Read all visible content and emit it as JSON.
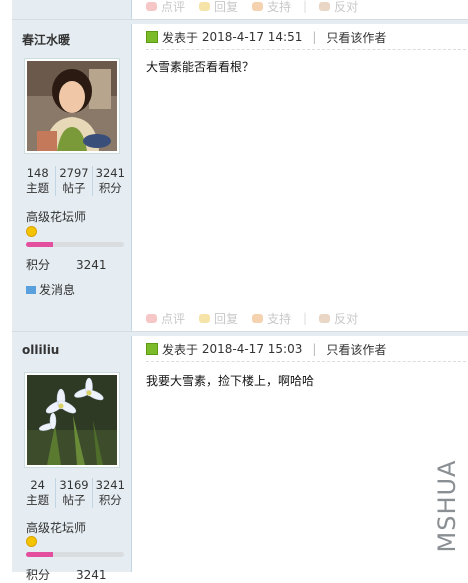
{
  "actions": {
    "comment": "点评",
    "reply": "回复",
    "support": "支持",
    "oppose": "反对"
  },
  "posts": [
    {
      "username": "春江水暖",
      "stats": [
        {
          "value": "148",
          "label": "主题"
        },
        {
          "value": "2797",
          "label": "帖子"
        },
        {
          "value": "3241",
          "label": "积分"
        }
      ],
      "rank": "高级花坛师",
      "level_progress": 0.28,
      "points_label": "积分",
      "points_value": "3241",
      "message_link": "发消息",
      "posted_prefix": "发表于",
      "posted_time": "2018-4-17 14:51",
      "only_author": "只看该作者",
      "content": "大雪素能否看看根？"
    },
    {
      "username": "olliliu",
      "stats": [
        {
          "value": "24",
          "label": "主题"
        },
        {
          "value": "3169",
          "label": "帖子"
        },
        {
          "value": "3241",
          "label": "积分"
        }
      ],
      "rank": "高级花坛师",
      "level_progress": 0.28,
      "points_label": "积分",
      "points_value": "3241",
      "posted_prefix": "发表于",
      "posted_time": "2018-4-17 15:03",
      "only_author": "只看该作者",
      "content": "我要大雪素，捡下楼上，啊哈哈"
    }
  ],
  "watermark": "MSHUA",
  "colors": {
    "sidebar_bg": "#e5edf2",
    "progress_fill": "#e34f9e",
    "border": "#c2d5e3"
  }
}
